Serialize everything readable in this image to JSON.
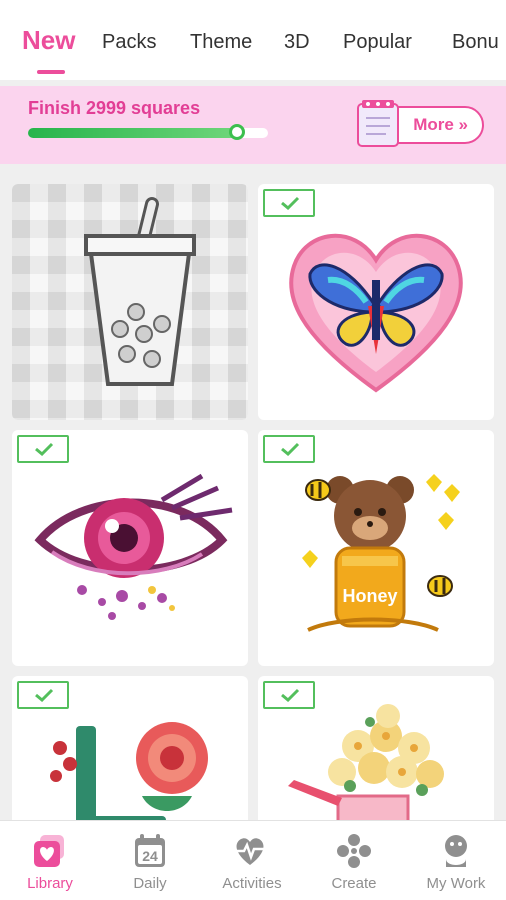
{
  "tabs": [
    {
      "label": "New",
      "active": true
    },
    {
      "label": "Packs"
    },
    {
      "label": "Theme"
    },
    {
      "label": "3D"
    },
    {
      "label": "Popular"
    },
    {
      "label": "Bonu"
    }
  ],
  "banner": {
    "title": "Finish 2999 squares",
    "progress": 0.87,
    "more_label": "More »"
  },
  "gallery": {
    "items": [
      {
        "name": "bubble-tea",
        "completed": false
      },
      {
        "name": "butterfly-heart",
        "completed": true
      },
      {
        "name": "pink-eye",
        "completed": true
      },
      {
        "name": "honey-bear",
        "completed": true,
        "art_text": "Honey"
      },
      {
        "name": "rose",
        "completed": true
      },
      {
        "name": "flower-watering-can",
        "completed": true
      }
    ]
  },
  "bottom_nav": [
    {
      "label": "Library",
      "icon": "library-icon",
      "active": true
    },
    {
      "label": "Daily",
      "icon": "calendar-icon",
      "badge": "24"
    },
    {
      "label": "Activities",
      "icon": "heartbeat-icon"
    },
    {
      "label": "Create",
      "icon": "create-icon"
    },
    {
      "label": "My Work",
      "icon": "profile-icon"
    }
  ],
  "colors": {
    "accent": "#ec4d9b",
    "banner_bg": "#fbd4ee",
    "check_green": "#53bf5c"
  }
}
